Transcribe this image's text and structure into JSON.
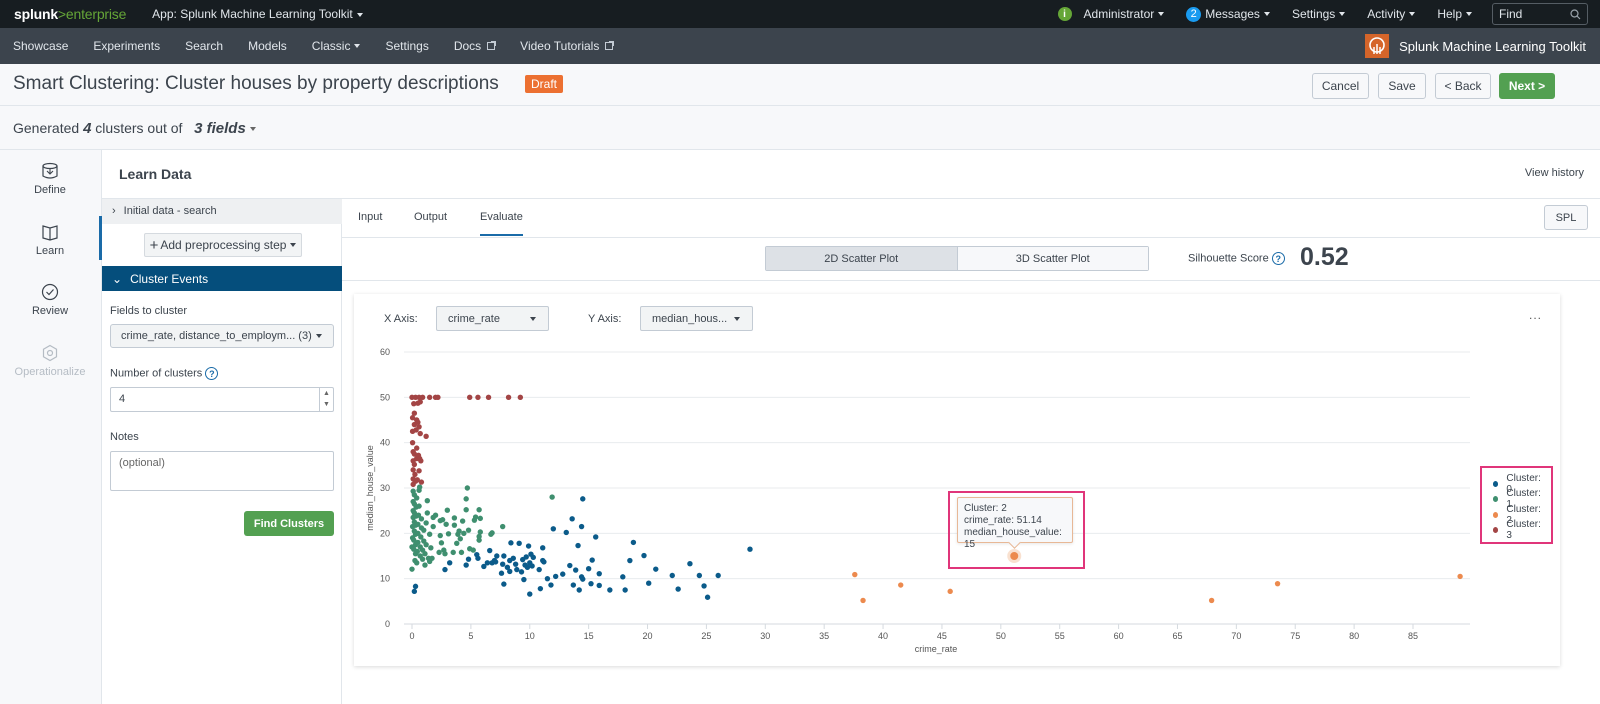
{
  "topbar": {
    "logo_main": "splunk",
    "logo_gt": ">",
    "logo_sub": "enterprise",
    "app_label": "App: Splunk Machine Learning Toolkit",
    "user_label": "Administrator",
    "messages_count": "2",
    "messages_label": "Messages",
    "settings_label": "Settings",
    "activity_label": "Activity",
    "help_label": "Help",
    "find_placeholder": "Find"
  },
  "navbar": {
    "items": [
      {
        "label": "Showcase"
      },
      {
        "label": "Experiments"
      },
      {
        "label": "Search"
      },
      {
        "label": "Models"
      },
      {
        "label": "Classic"
      },
      {
        "label": "Settings"
      },
      {
        "label": "Docs"
      },
      {
        "label": "Video Tutorials"
      }
    ],
    "brand_label": "Splunk Machine Learning Toolkit"
  },
  "header": {
    "title": "Smart Clustering: Cluster houses by property descriptions",
    "badge": "Draft",
    "cancel_label": "Cancel",
    "save_label": "Save",
    "back_label": "< Back",
    "next_label": "Next >"
  },
  "summary": {
    "prefix": "Generated",
    "clusters": "4",
    "middle": "clusters out of",
    "fields": "3 fields"
  },
  "steps": [
    {
      "label": "Define",
      "icon": "database-icon",
      "state": "default"
    },
    {
      "label": "Learn",
      "icon": "book-icon",
      "state": "active"
    },
    {
      "label": "Review",
      "icon": "check-circle-icon",
      "state": "default"
    },
    {
      "label": "Operationalize",
      "icon": "gear-icon",
      "state": "disabled"
    }
  ],
  "main": {
    "title": "Learn Data",
    "view_history": "View history"
  },
  "left_panel": {
    "initial_data": "Initial data - search",
    "add_step": "Add preprocessing step",
    "cluster_events": "Cluster Events",
    "fields_label": "Fields to cluster",
    "fields_value": "crime_rate, distance_to_employm... (3)",
    "num_clusters_label": "Number of clusters",
    "num_clusters_value": "4",
    "notes_label": "Notes",
    "notes_placeholder": "(optional)",
    "find_clusters": "Find Clusters"
  },
  "tabs": [
    {
      "label": "Input",
      "active": false
    },
    {
      "label": "Output",
      "active": false
    },
    {
      "label": "Evaluate",
      "active": true
    }
  ],
  "spl_label": "SPL",
  "plot_toggle": {
    "option_2d": "2D Scatter Plot",
    "option_3d": "3D Scatter Plot",
    "selected": "2D Scatter Plot"
  },
  "silhouette": {
    "label": "Silhouette Score",
    "value": "0.52"
  },
  "axis_controls": {
    "x_label": "X Axis:",
    "x_value": "crime_rate",
    "y_label": "Y Axis:",
    "y_value": "median_hous..."
  },
  "more_label": "...",
  "tooltip": {
    "line1": "Cluster: 2",
    "line2": "crime_rate: 51.14",
    "line3": "median_house_value: 15"
  },
  "chart_data": {
    "type": "scatter",
    "title": "",
    "xlabel": "crime_rate",
    "ylabel": "median_house_value",
    "xlim": [
      0,
      89
    ],
    "ylim": [
      0,
      60
    ],
    "xticks": [
      "0",
      "5",
      "10",
      "15",
      "20",
      "25",
      "30",
      "35",
      "40",
      "45",
      "50",
      "55",
      "60",
      "65",
      "70",
      "75",
      "80",
      "85"
    ],
    "yticks": [
      "0",
      "10",
      "20",
      "30",
      "40",
      "50",
      "60"
    ],
    "grid": true,
    "legend_position": "right",
    "series": [
      {
        "name": "Cluster: 0",
        "color": "#0b5b8a",
        "points": [
          [
            0.2,
            7.2
          ],
          [
            0.3,
            8.3
          ],
          [
            3.2,
            13.5
          ],
          [
            2.8,
            12
          ],
          [
            4.6,
            13
          ],
          [
            4.8,
            14.3
          ],
          [
            5.5,
            15.3
          ],
          [
            5.6,
            14.5
          ],
          [
            6.1,
            12.7
          ],
          [
            6.4,
            13.5
          ],
          [
            6.6,
            16.2
          ],
          [
            6.8,
            13.5
          ],
          [
            7.0,
            14
          ],
          [
            7.2,
            15
          ],
          [
            7.1,
            13.7
          ],
          [
            7.6,
            11.2
          ],
          [
            7.7,
            13.2
          ],
          [
            7.8,
            15
          ],
          [
            7.8,
            8.8
          ],
          [
            8.1,
            12.5
          ],
          [
            8.3,
            14
          ],
          [
            8.3,
            11.6
          ],
          [
            8.4,
            17.9
          ],
          [
            8.6,
            14.5
          ],
          [
            8.8,
            13.2
          ],
          [
            8.9,
            12
          ],
          [
            9.1,
            17.8
          ],
          [
            9.3,
            11.5
          ],
          [
            9.4,
            14.2
          ],
          [
            9.5,
            9.8
          ],
          [
            9.6,
            13
          ],
          [
            9.7,
            14.8
          ],
          [
            9.8,
            12.5
          ],
          [
            9.9,
            17.2
          ],
          [
            10.0,
            13.5
          ],
          [
            10.1,
            15.4
          ],
          [
            10.2,
            12.8
          ],
          [
            10.3,
            14.7
          ],
          [
            10.0,
            6.6
          ],
          [
            10.8,
            12
          ],
          [
            10.9,
            7.8
          ],
          [
            11.1,
            16.8
          ],
          [
            11.1,
            14
          ],
          [
            11.2,
            13.7
          ],
          [
            11.5,
            10
          ],
          [
            11.8,
            8.6
          ],
          [
            12.0,
            21
          ],
          [
            12.2,
            10.5
          ],
          [
            12.8,
            11
          ],
          [
            13.1,
            20.2
          ],
          [
            13.4,
            12.9
          ],
          [
            13.6,
            23.2
          ],
          [
            13.7,
            8.6
          ],
          [
            13.9,
            11.9
          ],
          [
            14.1,
            17.3
          ],
          [
            14.2,
            7.5
          ],
          [
            14.4,
            10.4
          ],
          [
            14.4,
            21.5
          ],
          [
            14.5,
            27.6
          ],
          [
            14.5,
            9.9
          ],
          [
            15.0,
            12.2
          ],
          [
            15.2,
            8.9
          ],
          [
            15.3,
            14.1
          ],
          [
            15.6,
            19.2
          ],
          [
            15.9,
            8.5
          ],
          [
            15.9,
            11.1
          ],
          [
            16.8,
            7.5
          ],
          [
            17.9,
            10.4
          ],
          [
            18.1,
            7.5
          ],
          [
            18.5,
            14
          ],
          [
            18.8,
            18
          ],
          [
            19.7,
            15.1
          ],
          [
            20.1,
            9
          ],
          [
            20.7,
            12.1
          ],
          [
            22.1,
            10.7
          ],
          [
            22.6,
            7.7
          ],
          [
            23.6,
            13.3
          ],
          [
            24.4,
            10.7
          ],
          [
            24.8,
            8.4
          ],
          [
            25.1,
            5.9
          ],
          [
            26.0,
            10.7
          ],
          [
            28.7,
            16.5
          ]
        ]
      },
      {
        "name": "Cluster: 1",
        "color": "#3f8f6f",
        "points": [
          [
            0.0,
            12.1
          ],
          [
            0.0,
            17
          ],
          [
            0.05,
            19
          ],
          [
            0.05,
            21.5
          ],
          [
            0.1,
            23.5
          ],
          [
            0.1,
            25
          ],
          [
            0.1,
            27
          ],
          [
            0.1,
            29.3
          ],
          [
            0.15,
            16.5
          ],
          [
            0.15,
            18.5
          ],
          [
            0.2,
            20.5
          ],
          [
            0.2,
            22.5
          ],
          [
            0.2,
            24.5
          ],
          [
            0.2,
            26.5
          ],
          [
            0.2,
            28.5
          ],
          [
            0.25,
            14
          ],
          [
            0.3,
            15.5
          ],
          [
            0.3,
            17.5
          ],
          [
            0.3,
            19.8
          ],
          [
            0.3,
            21.8
          ],
          [
            0.35,
            23.8
          ],
          [
            0.35,
            25.8
          ],
          [
            0.4,
            27.8
          ],
          [
            0.4,
            13.5
          ],
          [
            0.45,
            16
          ],
          [
            0.5,
            18
          ],
          [
            0.5,
            20
          ],
          [
            0.5,
            22
          ],
          [
            0.55,
            24
          ],
          [
            0.6,
            26
          ],
          [
            0.6,
            29.5
          ],
          [
            0.65,
            30.2
          ],
          [
            0.7,
            15
          ],
          [
            0.7,
            17
          ],
          [
            0.75,
            19.2
          ],
          [
            0.8,
            21.2
          ],
          [
            0.8,
            23.2
          ],
          [
            0.9,
            14.3
          ],
          [
            0.9,
            16.3
          ],
          [
            1.0,
            18.3
          ],
          [
            1.0,
            20.7
          ],
          [
            1.1,
            13
          ],
          [
            1.1,
            15.5
          ],
          [
            1.2,
            17.5
          ],
          [
            1.2,
            22.3
          ],
          [
            1.3,
            27.2
          ],
          [
            1.3,
            24.5
          ],
          [
            1.4,
            14.5
          ],
          [
            1.5,
            13.8
          ],
          [
            1.5,
            19.8
          ],
          [
            1.6,
            16.8
          ],
          [
            1.7,
            14.5
          ],
          [
            1.8,
            21.5
          ],
          [
            1.8,
            23.5
          ],
          [
            2.0,
            24
          ],
          [
            2.3,
            15.8
          ],
          [
            2.4,
            19.5
          ],
          [
            2.4,
            22.8
          ],
          [
            2.5,
            17.9
          ],
          [
            2.6,
            23
          ],
          [
            2.7,
            16.3
          ],
          [
            2.8,
            15.5
          ],
          [
            2.9,
            22
          ],
          [
            3.0,
            25.1
          ],
          [
            3.1,
            19.9
          ],
          [
            3.5,
            15.8
          ],
          [
            3.6,
            23.4
          ],
          [
            3.6,
            21.8
          ],
          [
            3.8,
            17.8
          ],
          [
            3.9,
            19.8
          ],
          [
            4.0,
            20.5
          ],
          [
            4.1,
            18.8
          ],
          [
            4.2,
            15.8
          ],
          [
            4.3,
            22.7
          ],
          [
            4.4,
            20
          ],
          [
            4.6,
            25.2
          ],
          [
            4.6,
            27.6
          ],
          [
            4.7,
            30
          ],
          [
            4.8,
            20.7
          ],
          [
            4.9,
            16.6
          ],
          [
            5.2,
            16.3
          ],
          [
            5.3,
            22.9
          ],
          [
            5.4,
            23.6
          ],
          [
            5.7,
            25.2
          ],
          [
            5.7,
            18.5
          ],
          [
            5.8,
            23.3
          ],
          [
            5.8,
            20.3
          ],
          [
            5.7,
            19.3
          ],
          [
            6.7,
            19.8
          ],
          [
            6.8,
            20.1
          ],
          [
            7.7,
            21.5
          ],
          [
            11.9,
            28
          ]
        ]
      },
      {
        "name": "Cluster: 2",
        "color": "#ec8a4e",
        "points": [
          [
            37.6,
            10.9
          ],
          [
            38.3,
            5.2
          ],
          [
            41.5,
            8.6
          ],
          [
            45.7,
            7.2
          ],
          [
            51.14,
            15
          ],
          [
            67.9,
            5.2
          ],
          [
            73.5,
            8.9
          ],
          [
            89.0,
            10.5
          ]
        ]
      },
      {
        "name": "Cluster: 3",
        "color": "#a34545",
        "points": [
          [
            0.0,
            50
          ],
          [
            0.05,
            45.5
          ],
          [
            0.05,
            42.5
          ],
          [
            0.05,
            40
          ],
          [
            0.1,
            38
          ],
          [
            0.1,
            36
          ],
          [
            0.1,
            34
          ],
          [
            0.1,
            32
          ],
          [
            0.1,
            30.8
          ],
          [
            0.15,
            48.6
          ],
          [
            0.2,
            46.5
          ],
          [
            0.2,
            44
          ],
          [
            0.2,
            37.5
          ],
          [
            0.2,
            35.2
          ],
          [
            0.25,
            33
          ],
          [
            0.3,
            31.5
          ],
          [
            0.3,
            50
          ],
          [
            0.35,
            42.8
          ],
          [
            0.4,
            45
          ],
          [
            0.4,
            38.8
          ],
          [
            0.4,
            36.5
          ],
          [
            0.45,
            31.8
          ],
          [
            0.5,
            48.7
          ],
          [
            0.5,
            44.5
          ],
          [
            0.55,
            37.2
          ],
          [
            0.6,
            50
          ],
          [
            0.6,
            43.5
          ],
          [
            0.6,
            33.8
          ],
          [
            0.65,
            36.5
          ],
          [
            0.7,
            49
          ],
          [
            0.7,
            42
          ],
          [
            0.75,
            36
          ],
          [
            0.8,
            31.3
          ],
          [
            0.9,
            50
          ],
          [
            1.2,
            41.4
          ],
          [
            1.5,
            50
          ],
          [
            2.0,
            50
          ],
          [
            2.2,
            50
          ],
          [
            4.9,
            50
          ],
          [
            5.6,
            50
          ],
          [
            6.5,
            50
          ],
          [
            8.2,
            50
          ],
          [
            9.2,
            50
          ]
        ]
      }
    ],
    "highlighted_point": {
      "cluster": "2",
      "x": 51.14,
      "y": 15
    }
  }
}
